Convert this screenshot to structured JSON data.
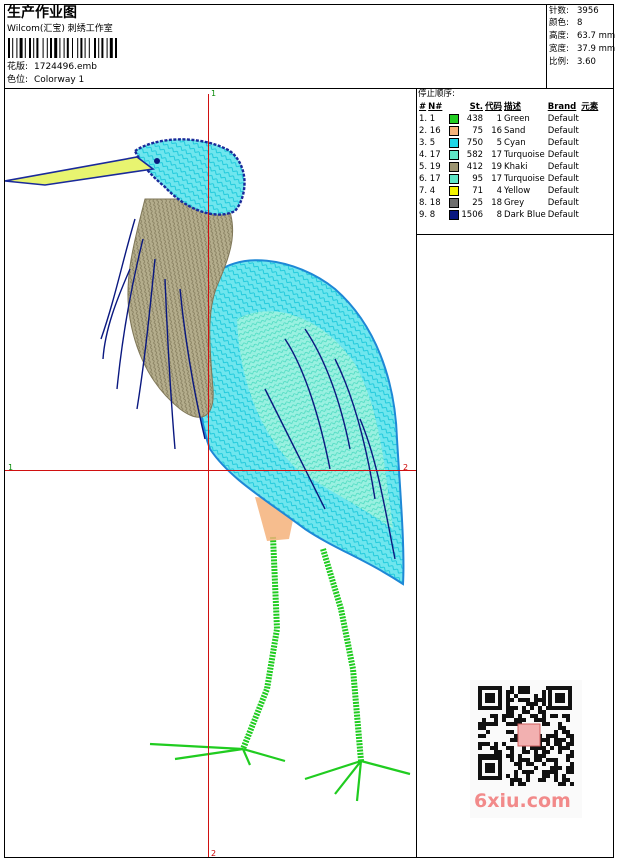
{
  "header": {
    "title": "生产作业图",
    "company": "Wilcom(汇宝) 刺绣工作室",
    "design_label": "花版:",
    "design_value": "1724496.emb",
    "colorway_label": "色位:",
    "colorway_value": "Colorway 1"
  },
  "stats": {
    "stitches_label": "针数:",
    "stitches_value": "3956",
    "colors_label": "颜色:",
    "colors_value": "8",
    "height_label": "高度:",
    "height_value": "63.7 mm",
    "width_label": "宽度:",
    "width_value": "37.9 mm",
    "ratio_label": "比例:",
    "ratio_value": "3.60"
  },
  "stop_sequence": {
    "title": "停止顺序:",
    "headers": [
      "#",
      "N#",
      "St.",
      "代码",
      "描述",
      "Brand",
      "元素"
    ],
    "rows": [
      {
        "idx": "1. 1",
        "st": "438",
        "code": "1",
        "desc": "Green",
        "brand": "Default",
        "color": "#22cc22"
      },
      {
        "idx": "2. 16",
        "st": "75",
        "code": "16",
        "desc": "Sand",
        "brand": "Default",
        "color": "#f5b27a"
      },
      {
        "idx": "3. 5",
        "st": "750",
        "code": "5",
        "desc": "Cyan",
        "brand": "Default",
        "color": "#1fd7e8"
      },
      {
        "idx": "4. 17",
        "st": "582",
        "code": "17",
        "desc": "Turquoise",
        "brand": "Default",
        "color": "#5fe6c6"
      },
      {
        "idx": "5. 19",
        "st": "412",
        "code": "19",
        "desc": "Khaki",
        "brand": "Default",
        "color": "#9c9470"
      },
      {
        "idx": "6. 17",
        "st": "95",
        "code": "17",
        "desc": "Turquoise",
        "brand": "Default",
        "color": "#5fe6c6"
      },
      {
        "idx": "7. 4",
        "st": "71",
        "code": "4",
        "desc": "Yellow",
        "brand": "Default",
        "color": "#f2f200"
      },
      {
        "idx": "8. 18",
        "st": "25",
        "code": "18",
        "desc": "Grey",
        "brand": "Default",
        "color": "#6e6e6e"
      },
      {
        "idx": "9. 8",
        "st": "1506",
        "code": "8",
        "desc": "Dark Blue",
        "brand": "Default",
        "color": "#0a1880"
      }
    ]
  },
  "crosshair": {
    "top_label": "1",
    "bottom_label": "2",
    "left_label": "1",
    "right_label": "2"
  },
  "watermark": {
    "site": "6xiu.com"
  }
}
